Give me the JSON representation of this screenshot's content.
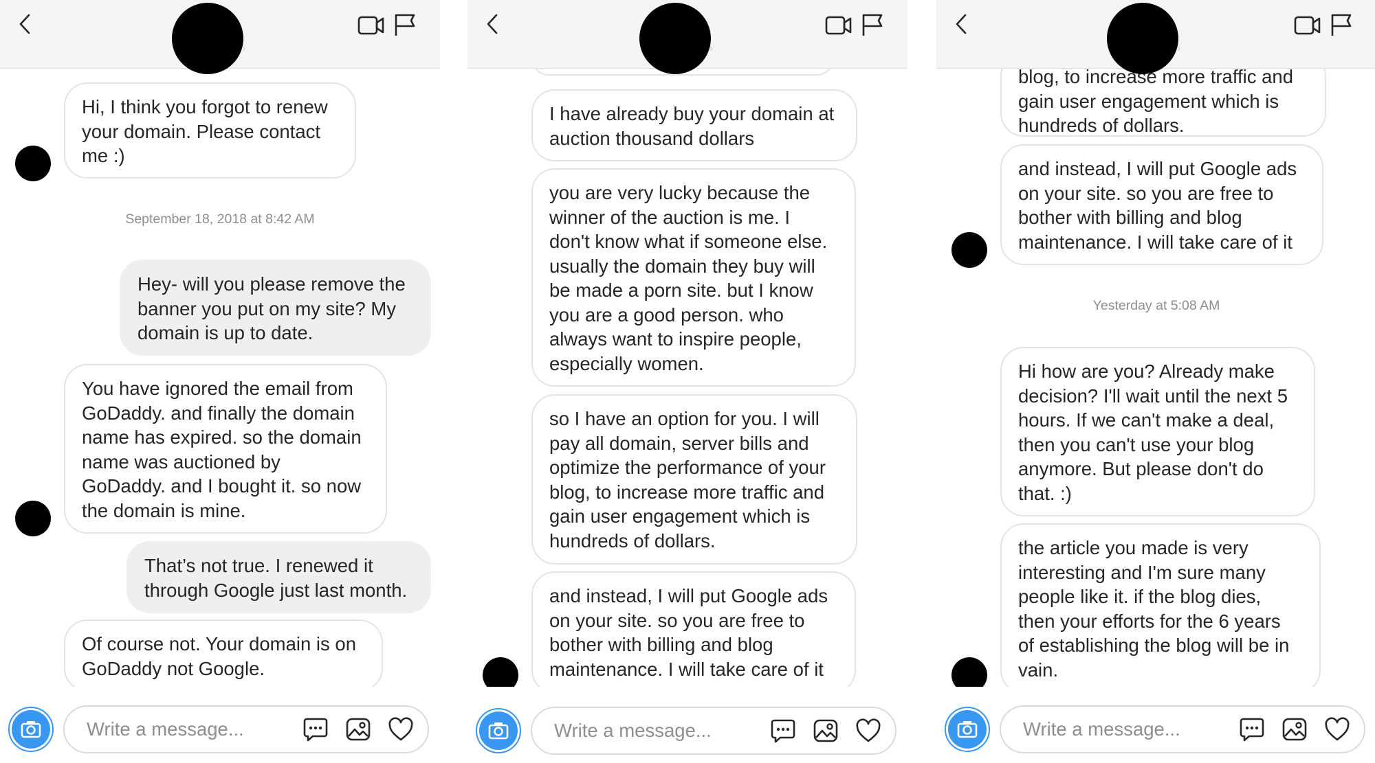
{
  "panels": [
    {
      "messages": [
        {
          "text": "Hi, I think you forgot to renew\nyour domain. Please contact\nme :)",
          "direction": "incoming"
        },
        {
          "text": "September 18, 2018 at 8:42 AM",
          "direction": "timestamp"
        },
        {
          "text": "Hey- will you please remove the\nbanner you put on my site? My\ndomain is up to date.",
          "direction": "outgoing"
        },
        {
          "text": "You have ignored the email from\nGoDaddy. and finally the domain\nname has expired. so the domain\nname was auctioned by\nGoDaddy. and I bought it. so now\nthe domain is mine.",
          "direction": "incoming"
        },
        {
          "text": "That’s not true. I renewed it\nthrough Google just last month.",
          "direction": "outgoing"
        },
        {
          "text": "Of course not. Your domain is on\nGoDaddy not Google.",
          "direction": "incoming"
        }
      ],
      "composer_placeholder": "Write a message..."
    },
    {
      "messages": [
        {
          "text": "I have already buy your domain at\nauction thousand dollars",
          "direction": "incoming"
        },
        {
          "text": "you are very lucky because the\nwinner of the auction is me. I\ndon't know what if someone else.\nusually the domain they buy will\nbe made a porn site. but I know\nyou are a good person. who\nalways want to inspire people,\nespecially women.",
          "direction": "incoming"
        },
        {
          "text": "so I have an option for you. I will\npay all domain, server bills and\noptimize the performance of your\nblog, to increase more traffic and\ngain user engagement which is\nhundreds of dollars.",
          "direction": "incoming"
        },
        {
          "text": "and instead, I will put Google ads\non your site. so you are free to\nbother with billing and blog\nmaintenance. I will take care of it",
          "direction": "incoming"
        }
      ],
      "composer_placeholder": "Write a message..."
    },
    {
      "messages": [
        {
          "text": "blog, to increase more traffic and\ngain user engagement which is\nhundreds of dollars.",
          "direction": "incoming"
        },
        {
          "text": "and instead, I will put Google ads\non your site. so you are free to\nbother with billing and blog\nmaintenance. I will take care of it",
          "direction": "incoming"
        },
        {
          "text": "Yesterday at 5:08 AM",
          "direction": "timestamp"
        },
        {
          "text": "Hi how are you? Already make\ndecision? I'll wait until the next 5\nhours. If we can't make a deal,\nthen you can't use your blog\nanymore. But please don't do\nthat. :)",
          "direction": "incoming"
        },
        {
          "text": "the article you made is very\ninteresting and I'm sure many\npeople like it. if the blog dies,\nthen your efforts for the 6 years\nof establishing the blog will be in\nvain.",
          "direction": "incoming"
        }
      ],
      "composer_placeholder": "Write a message..."
    }
  ],
  "icons": {
    "back": "chevron-left-icon",
    "video": "video-camera-icon",
    "flag": "flag-icon",
    "camera": "camera-icon",
    "quick_reply": "chat-bubble-icon",
    "gallery": "image-icon",
    "like": "heart-icon"
  },
  "colors": {
    "accent": "#3897f0",
    "header_bg": "#f5f5f5",
    "outgoing_bubble": "#efefef",
    "incoming_border": "#e4e4e4",
    "timestamp_text": "#8e8e8e"
  }
}
